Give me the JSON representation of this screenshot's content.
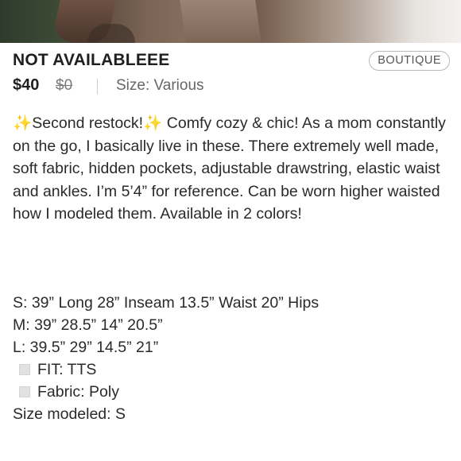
{
  "listing": {
    "title": "NOT AVAILABLEEE",
    "badge": "BOUTIQUE",
    "price": "$40",
    "original_price": "$0",
    "size": "Size: Various"
  },
  "description": {
    "sparkle": "✨",
    "restock": "Second restock!",
    "body": " Comfy cozy & chic! As a mom constantly on the go, I basically live in these. There extremely well made, soft fabric, hidden pockets, adjustable drawstring, elastic waist and ankles. I’m 5’4” for reference. Can be worn higher waisted how I modeled them. Available in 2 colors!"
  },
  "specs": {
    "s": "S: 39” Long 28” Inseam 13.5” Waist 20” Hips",
    "m": "M: 39” 28.5” 14” 20.5”",
    "l": "L: 39.5” 29” 14.5” 21”",
    "fit": "FIT: TTS",
    "fabric": "Fabric: Poly",
    "modeled": "Size modeled: S"
  }
}
